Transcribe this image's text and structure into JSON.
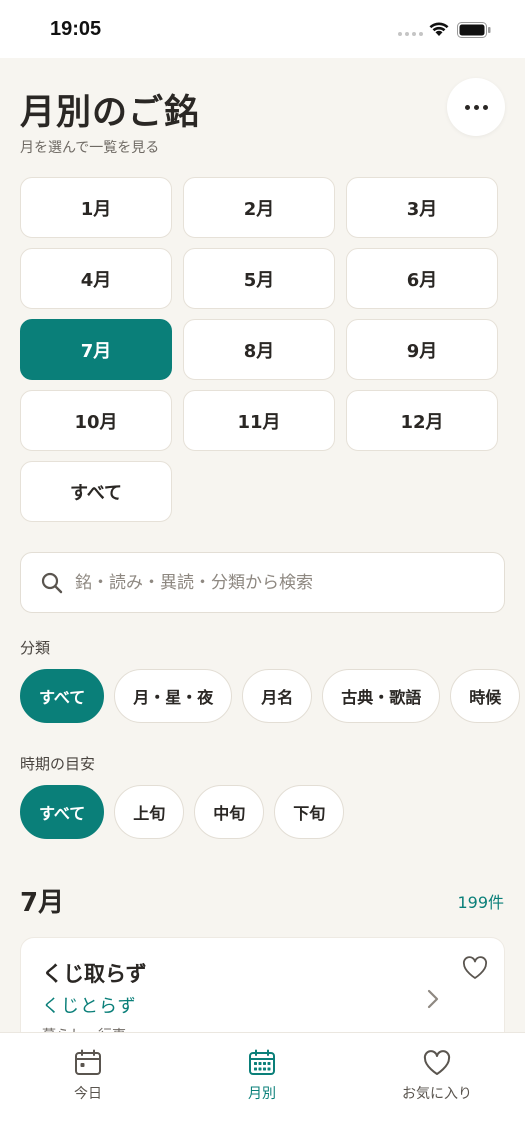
{
  "status_bar": {
    "time": "19:05"
  },
  "header": {
    "title": "月別のご銘",
    "subtitle": "月を選んで一覧を見る"
  },
  "months": [
    "1月",
    "2月",
    "3月",
    "4月",
    "5月",
    "6月",
    "7月",
    "8月",
    "9月",
    "10月",
    "11月",
    "12月",
    "すべて"
  ],
  "selected_month": "7月",
  "search": {
    "placeholder": "銘・読み・異読・分類から検索",
    "value": ""
  },
  "category_filter": {
    "label": "分類",
    "options": [
      "すべて",
      "月・星・夜",
      "月名",
      "古典・歌語",
      "時候"
    ],
    "selected": "すべて"
  },
  "period_filter": {
    "label": "時期の目安",
    "options": [
      "すべて",
      "上旬",
      "中旬",
      "下旬"
    ],
    "selected": "すべて"
  },
  "results": {
    "title": "7月",
    "count": "199件",
    "items": [
      {
        "title": "くじ取らず",
        "reading": "くじとらず",
        "category": "暮らし・行事"
      }
    ]
  },
  "tab_bar": {
    "tabs": [
      {
        "label": "今日",
        "icon": "calendar-icon"
      },
      {
        "label": "月別",
        "icon": "calendar-grid-icon"
      },
      {
        "label": "お気に入り",
        "icon": "heart-icon"
      }
    ],
    "active": "月別"
  },
  "colors": {
    "accent": "#0a7f79",
    "background": "#f7f5f0",
    "surface": "#ffffff",
    "text": "#2a2724"
  }
}
